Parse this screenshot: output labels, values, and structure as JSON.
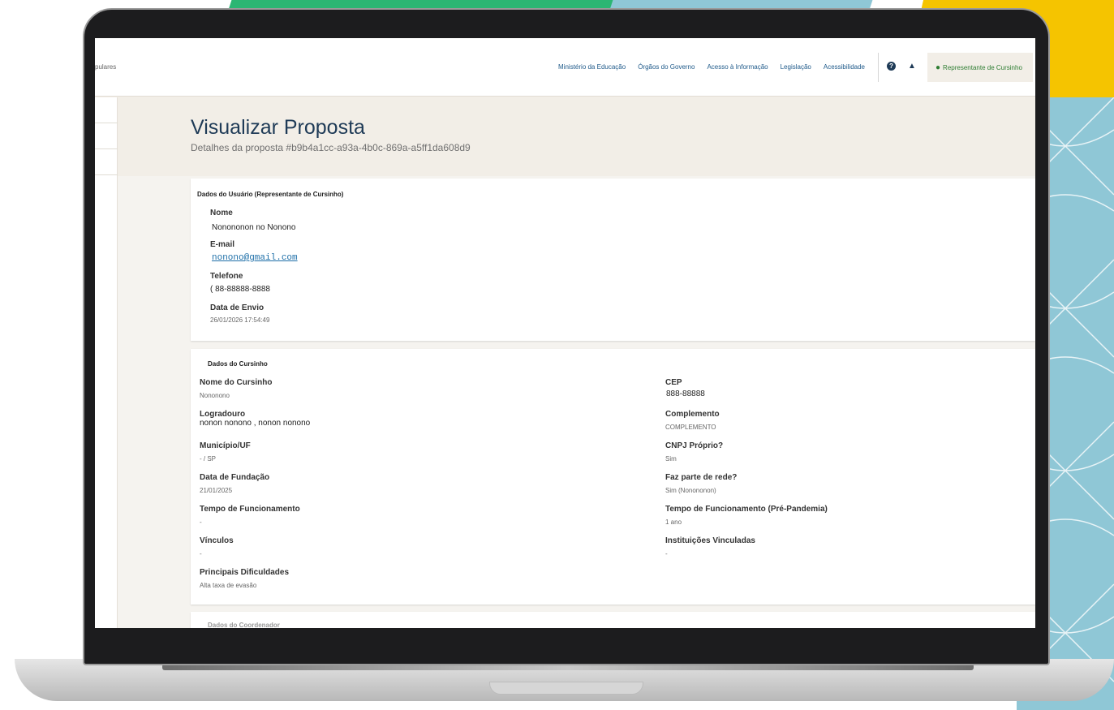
{
  "topbar": {
    "brand_cut": "pulares",
    "links": [
      "Ministério da Educação",
      "Órgãos do Governo",
      "Acesso à Informação",
      "Legislação",
      "Acessibilidade"
    ],
    "help_icon": "question-circle-icon",
    "bell_icon": "bell-icon",
    "user_icon": "user-icon",
    "user_label": "Representante de Cursinho"
  },
  "page": {
    "title": "Visualizar Proposta",
    "subtitle": "Detalhes da proposta #b9b4a1cc-a93a-4b0c-869a-a5ff1da608d9"
  },
  "usuario": {
    "heading": "Dados do Usuário (Representante de Cursinho)",
    "nome_label": "Nome",
    "nome_value": "Nonononon no Nonono",
    "email_label": "E-mail",
    "email_value": "nonono@gmail.com",
    "telefone_label": "Telefone",
    "telefone_value": "( 88-88888-8888",
    "envio_label": "Data de Envio",
    "envio_value": "26/01/2026 17:54:49"
  },
  "cursinho": {
    "heading": "Dados do Cursinho",
    "left": [
      {
        "label": "Nome do Cursinho",
        "value": "Nononono"
      },
      {
        "label": "Logradouro",
        "value": "nonon nonono , nonon nonono"
      },
      {
        "label": "Município/UF",
        "value": "- / SP"
      },
      {
        "label": "Data de Fundação",
        "value": "21/01/2025"
      },
      {
        "label": "Tempo de Funcionamento",
        "value": "-"
      },
      {
        "label": "Vínculos",
        "value": "-"
      },
      {
        "label": "Principais Dificuldades",
        "value": "Alta taxa de evasão"
      }
    ],
    "right": [
      {
        "label": "CEP",
        "value": "888-88888"
      },
      {
        "label": "Complemento",
        "value": "COMPLEMENTO"
      },
      {
        "label": "CNPJ Próprio?",
        "value": "Sim"
      },
      {
        "label": "Faz parte de rede?",
        "value": "Sim (Nonononon)"
      },
      {
        "label": "Tempo de Funcionamento (Pré-Pandemia)",
        "value": "1 ano"
      },
      {
        "label": "Instituições Vinculadas",
        "value": "-"
      }
    ]
  },
  "next_card": {
    "heading": "Dados do Coordenador"
  },
  "colors": {
    "accent": "#1f3b57",
    "link": "#1e6fa8",
    "user_green": "#2e7d32",
    "page_bg": "#f2eee7"
  }
}
